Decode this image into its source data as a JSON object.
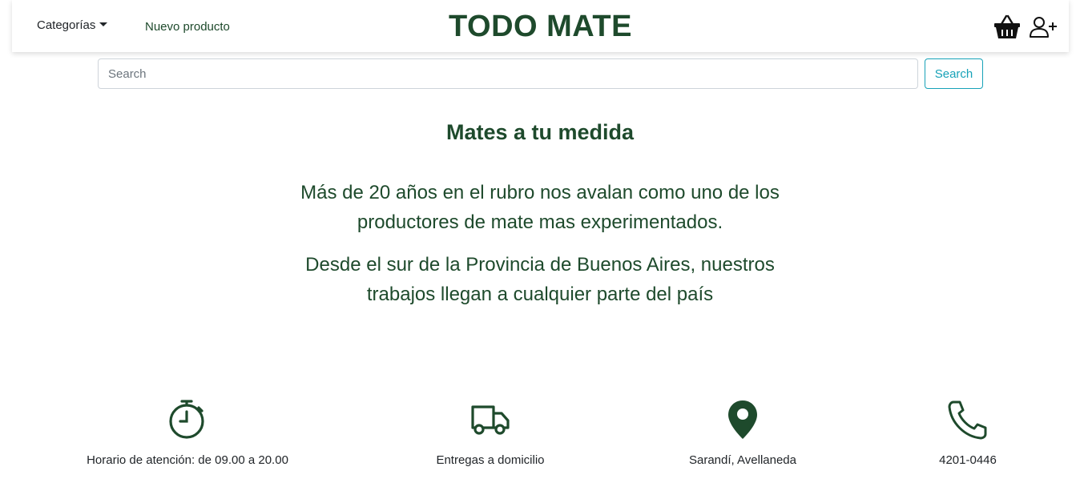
{
  "nav": {
    "categorias_label": "Categorías",
    "nuevo_producto_label": "Nuevo producto",
    "brand": "TODO MATE",
    "cart_icon": "basket-icon",
    "user_icon": "user-plus-icon"
  },
  "search": {
    "placeholder": "Search",
    "value": "",
    "button_label": "Search"
  },
  "hero": {
    "title": "Mates a tu medida",
    "paragraph1": "Más de 20 años en el rubro nos avalan como uno de los productores de mate mas experimentados.",
    "paragraph2": "Desde el sur de la Provincia de Buenos Aires, nuestros trabajos llegan a cualquier parte del país"
  },
  "features": [
    {
      "icon": "stopwatch-icon",
      "label": "Horario de atención: de 09.00 a 20.00"
    },
    {
      "icon": "truck-icon",
      "label": "Entregas a domicilio"
    },
    {
      "icon": "location-pin-icon",
      "label": "Sarandí, Avellaneda"
    },
    {
      "icon": "phone-icon",
      "label": "4201-0446"
    }
  ],
  "colors": {
    "brand_green": "#1e4a2c",
    "info_button": "#17a2b8"
  }
}
